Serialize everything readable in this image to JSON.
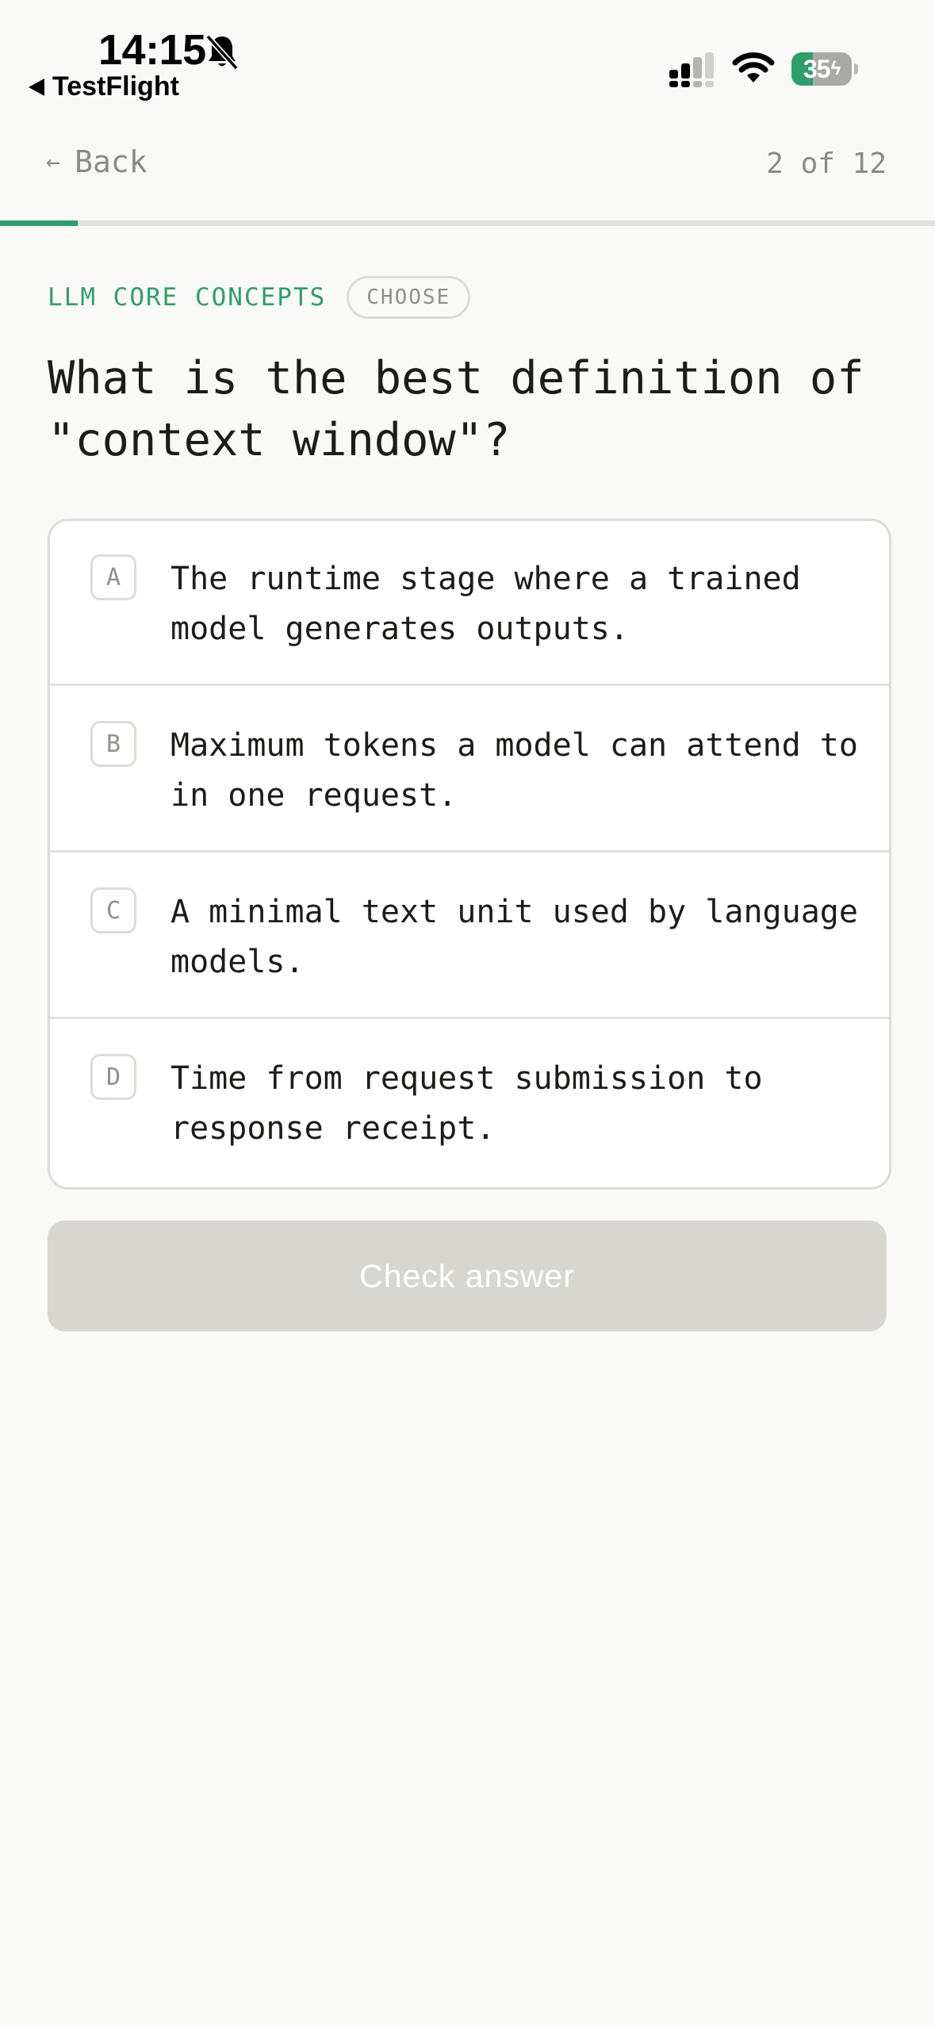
{
  "status_bar": {
    "time": "14:15",
    "back_app_label": "TestFlight",
    "battery_level": "35",
    "battery_fraction": 0.35,
    "icons": [
      "bell-slash-icon",
      "signal-icon",
      "wifi-icon",
      "battery-charging-icon"
    ]
  },
  "nav": {
    "back_label": "Back",
    "back_icon": "arrow-left-icon",
    "counter": "2 of 12"
  },
  "progress": {
    "current": 2,
    "total": 12,
    "fraction": 0.083
  },
  "question": {
    "topic": "LLM CORE CONCEPTS",
    "mode": "CHOOSE",
    "text": "What is the best definition of \"context window\"?"
  },
  "options": [
    {
      "key": "A",
      "text": "The runtime stage where a trained model generates outputs."
    },
    {
      "key": "B",
      "text": "Maximum tokens a model can attend to in one request."
    },
    {
      "key": "C",
      "text": "A minimal text unit used by language models."
    },
    {
      "key": "D",
      "text": "Time from request submission to response receipt."
    }
  ],
  "actions": {
    "check_label": "Check answer",
    "check_enabled": false
  },
  "colors": {
    "accent": "#2f9e6a",
    "background": "#f9f9f7",
    "muted_text": "#8a8a86",
    "disabled_button": "#d8d6d1"
  }
}
